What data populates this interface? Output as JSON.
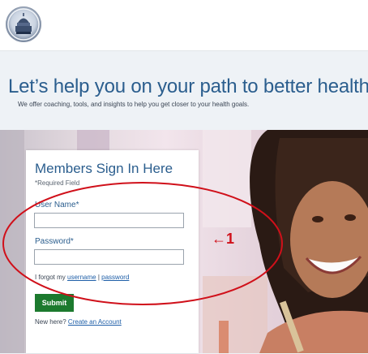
{
  "header": {
    "logo_icon": "state-capitol-seal-icon"
  },
  "banner": {
    "headline": "Let’s help you on your path to better health",
    "subtext": "We offer coaching, tools, and insights to help you get closer to your health goals."
  },
  "signin": {
    "title": "Members Sign In Here",
    "required_note": "*Required Field",
    "username_label": "User Name*",
    "username_value": "",
    "password_label": "Password*",
    "password_value": "",
    "forgot_prefix": "I forgot my",
    "forgot_username": "username",
    "forgot_separator": "|",
    "forgot_password": "password",
    "submit_label": "Submit",
    "newhere_prefix": "New here?",
    "create_account": "Create an Account",
    "submit_color": "#1c7a2e"
  },
  "annotation": {
    "label": "←1",
    "color": "#d0101a"
  },
  "colors": {
    "brand_blue": "#2b5e8e",
    "link_blue": "#1f5fa8"
  }
}
